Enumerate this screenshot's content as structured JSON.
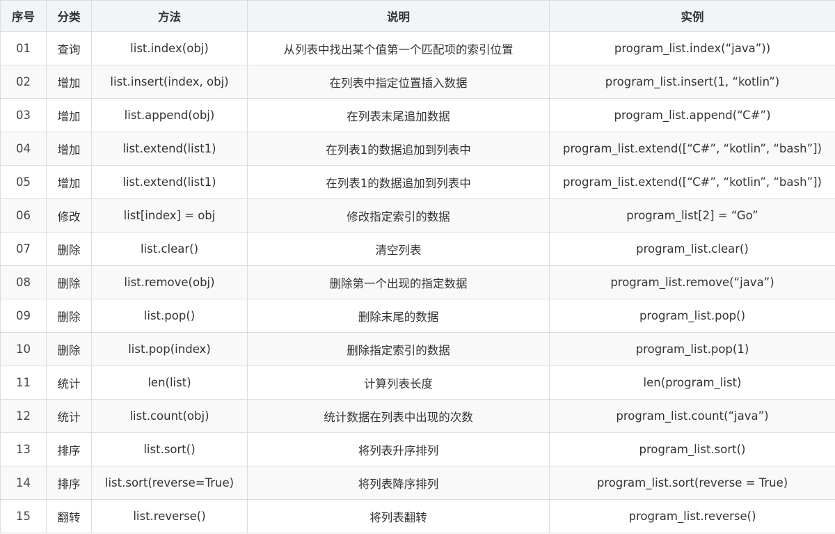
{
  "headers": [
    "序号",
    "分类",
    "方法",
    "说明",
    "实例"
  ],
  "rows": [
    {
      "no": "01",
      "category": "查询",
      "method": "list.index(obj)",
      "desc": "从列表中找出某个值第一个匹配项的索引位置",
      "example": "program_list.index(“java”))"
    },
    {
      "no": "02",
      "category": "增加",
      "method": "list.insert(index, obj)",
      "desc": "在列表中指定位置插入数据",
      "example": "program_list.insert(1, “kotlin”)"
    },
    {
      "no": "03",
      "category": "增加",
      "method": "list.append(obj)",
      "desc": "在列表末尾追加数据",
      "example": "program_list.append(“C#”)"
    },
    {
      "no": "04",
      "category": "增加",
      "method": "list.extend(list1)",
      "desc": "在列表1的数据追加到列表中",
      "example": "program_list.extend([“C#”, “kotlin”, “bash”])"
    },
    {
      "no": "05",
      "category": "增加",
      "method": "list.extend(list1)",
      "desc": "在列表1的数据追加到列表中",
      "example": "program_list.extend([“C#”, “kotlin”, “bash”])"
    },
    {
      "no": "06",
      "category": "修改",
      "method": "list[index] = obj",
      "desc": "修改指定索引的数据",
      "example": "program_list[2] = “Go”"
    },
    {
      "no": "07",
      "category": "删除",
      "method": "list.clear()",
      "desc": "清空列表",
      "example": "program_list.clear()"
    },
    {
      "no": "08",
      "category": "删除",
      "method": "list.remove(obj)",
      "desc": "删除第一个出现的指定数据",
      "example": "program_list.remove(“java”)"
    },
    {
      "no": "09",
      "category": "删除",
      "method": "list.pop()",
      "desc": "删除末尾的数据",
      "example": "program_list.pop()"
    },
    {
      "no": "10",
      "category": "删除",
      "method": "list.pop(index)",
      "desc": "删除指定索引的数据",
      "example": "program_list.pop(1)"
    },
    {
      "no": "11",
      "category": "统计",
      "method": "len(list)",
      "desc": "计算列表长度",
      "example": "len(program_list)"
    },
    {
      "no": "12",
      "category": "统计",
      "method": "list.count(obj)",
      "desc": "统计数据在列表中出现的次数",
      "example": "program_list.count(“java”)"
    },
    {
      "no": "13",
      "category": "排序",
      "method": "list.sort()",
      "desc": "将列表升序排列",
      "example": "program_list.sort()"
    },
    {
      "no": "14",
      "category": "排序",
      "method": "list.sort(reverse=True)",
      "desc": "将列表降序排列",
      "example": "program_list.sort(reverse = True)"
    },
    {
      "no": "15",
      "category": "翻转",
      "method": "list.reverse()",
      "desc": "将列表翻转",
      "example": "program_list.reverse()"
    }
  ]
}
